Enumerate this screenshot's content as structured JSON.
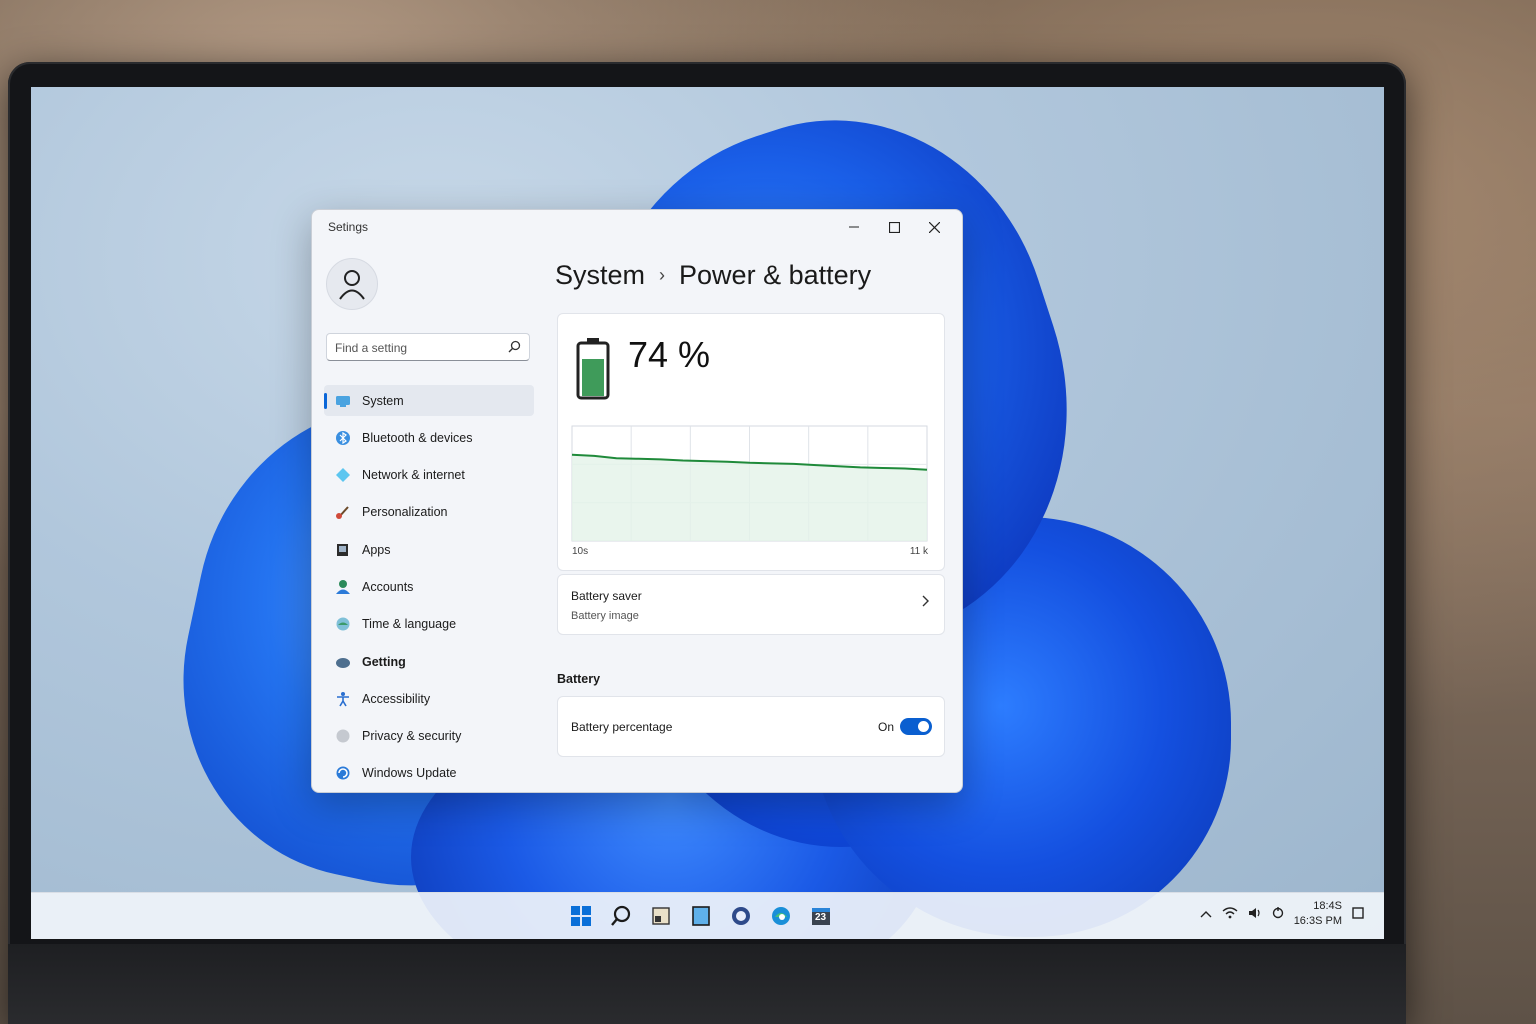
{
  "window": {
    "title": "Setings",
    "controls": {
      "minimize": "–",
      "maximize": "☐",
      "close": "✕"
    }
  },
  "search": {
    "placeholder": "Find a setting",
    "icon": "search-icon"
  },
  "breadcrumb": {
    "parent": "System",
    "separator": "›",
    "current": "Power & battery"
  },
  "sidebar": {
    "items": [
      {
        "label": "System",
        "icon": "monitor-icon",
        "active": true
      },
      {
        "label": "Bluetooth & devices",
        "icon": "bluetooth-icon"
      },
      {
        "label": "Network & internet",
        "icon": "network-icon"
      },
      {
        "label": "Personalization",
        "icon": "brush-icon"
      },
      {
        "label": "Apps",
        "icon": "apps-icon"
      },
      {
        "label": "Accounts",
        "icon": "accounts-icon"
      },
      {
        "label": "Time & language",
        "icon": "globe-icon"
      },
      {
        "label": "Getting",
        "icon": "gaming-icon"
      },
      {
        "label": "Accessibility",
        "icon": "accessibility-icon"
      },
      {
        "label": "Privacy & security",
        "icon": "shield-icon"
      },
      {
        "label": "Windows Update",
        "icon": "update-icon"
      }
    ]
  },
  "battery": {
    "percent_label": "74 %",
    "level": 0.74,
    "fill_color": "#3f9b5a"
  },
  "chart_data": {
    "type": "area",
    "x_start_label": "10s",
    "x_end_label": "11 k",
    "y_values": [
      75,
      74,
      72,
      71.5,
      71,
      70,
      69.5,
      69,
      68,
      67.5,
      67,
      66,
      65,
      64,
      63.5,
      63,
      62
    ],
    "ylim": [
      0,
      100
    ],
    "line_color": "#1f8a3a",
    "fill_color": "#e3f2e8",
    "grid": true
  },
  "battery_saver": {
    "title": "Battery saver",
    "subtitle": "Battery image"
  },
  "battery_section": {
    "label": "Battery",
    "percentage_setting": {
      "label": "Battery percentage",
      "state_label": "On",
      "on": true
    }
  },
  "taskbar": {
    "icons": [
      "windows-start-icon",
      "search-icon",
      "widgets-icon",
      "file-explorer-icon",
      "chat-icon",
      "edge-icon",
      "calendar-icon"
    ],
    "calendar_badge": "23",
    "clock": {
      "line1": "18:4S",
      "line2": "16:3S PM"
    }
  }
}
